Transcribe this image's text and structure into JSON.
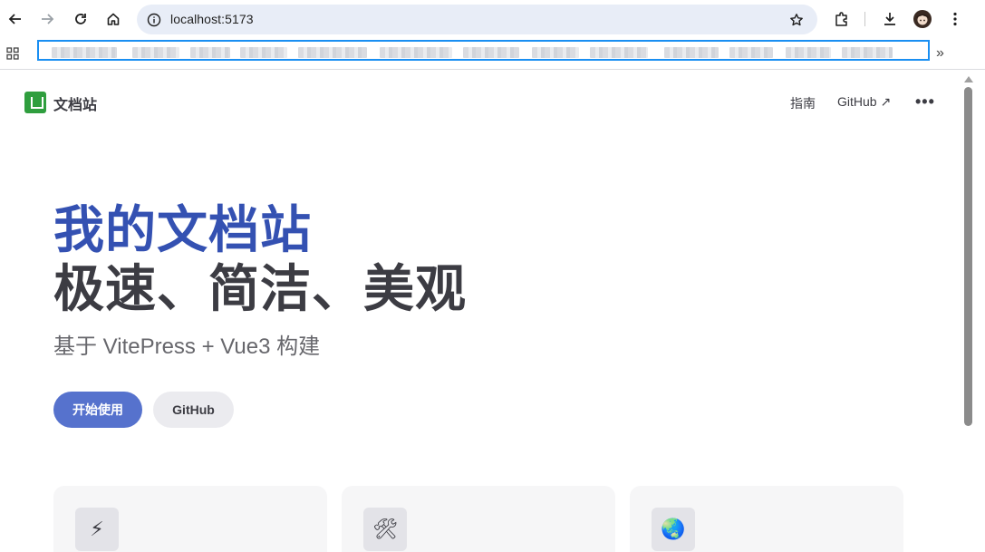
{
  "browser": {
    "url": "localhost:5173",
    "icons": [
      "back-icon",
      "forward-icon",
      "reload-icon",
      "home-icon",
      "site-info-icon",
      "bookmark-star-icon",
      "extensions-icon",
      "download-icon",
      "profile-avatar",
      "menu-kebab-icon",
      "apps-grid-icon",
      "chevron-double-right-icon"
    ]
  },
  "nav": {
    "site_title": "文档站",
    "links": [
      "指南",
      "GitHub ↗"
    ],
    "more": "•••"
  },
  "hero": {
    "name": "我的文档站",
    "text": "极速、简洁、美观",
    "tagline": "基于 VitePress + Vue3 构建",
    "actions": [
      "开始使用",
      "GitHub"
    ]
  },
  "features": [
    {
      "icon": "⚡"
    },
    {
      "icon": "🛠"
    },
    {
      "icon": "🌏"
    }
  ],
  "colors": {
    "brand": "#5672cd",
    "hero_name": "#3451b2",
    "highlight": "#1a8ff2"
  }
}
